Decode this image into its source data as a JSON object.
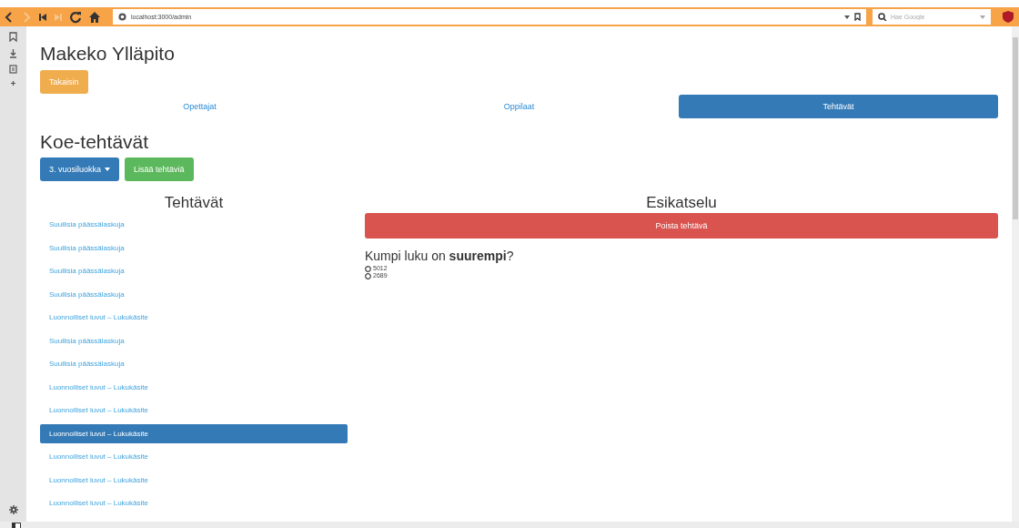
{
  "browser": {
    "address": "localhost:3000/admin",
    "search": {
      "placeholder": "Hae Google"
    }
  },
  "page_title": "Makeko Ylläpito",
  "back_button": "Takaisin",
  "tabs": [
    {
      "label": "Opettajat",
      "selected": false
    },
    {
      "label": "Oppilaat",
      "selected": false
    },
    {
      "label": "Tehtävät",
      "selected": true
    }
  ],
  "section_title": "Koe-tehtävät",
  "grade_dropdown": "3. vuosiluokka",
  "add_button": "Lisää tehtäviä",
  "tasks": {
    "heading": "Tehtävät",
    "items": [
      {
        "label": "Suullisia päässälaskuja",
        "selected": false
      },
      {
        "label": "Suullisia päässälaskuja",
        "selected": false
      },
      {
        "label": "Suullisia päässälaskuja",
        "selected": false
      },
      {
        "label": "Suullisia päässälaskuja",
        "selected": false
      },
      {
        "label": "Luonnolliset luvut – Lukukäsite",
        "selected": false
      },
      {
        "label": "Suullisia päässälaskuja",
        "selected": false
      },
      {
        "label": "Suullisia päässälaskuja",
        "selected": false
      },
      {
        "label": "Luonnolliset luvut – Lukukäsite",
        "selected": false
      },
      {
        "label": "Luonnolliset luvut – Lukukäsite",
        "selected": false
      },
      {
        "label": "Luonnolliset luvut – Lukukäsite",
        "selected": true
      },
      {
        "label": "Luonnolliset luvut – Lukukäsite",
        "selected": false
      },
      {
        "label": "Luonnolliset luvut – Lukukäsite",
        "selected": false
      },
      {
        "label": "Luonnolliset luvut – Lukukäsite",
        "selected": false
      }
    ]
  },
  "preview": {
    "heading": "Esikatselu",
    "delete_button": "Poista tehtävä",
    "question": "Kumpi luku on **suurempi**?",
    "options": [
      {
        "label": "5012",
        "selected": false
      },
      {
        "label": "2689",
        "selected": false
      }
    ]
  }
}
